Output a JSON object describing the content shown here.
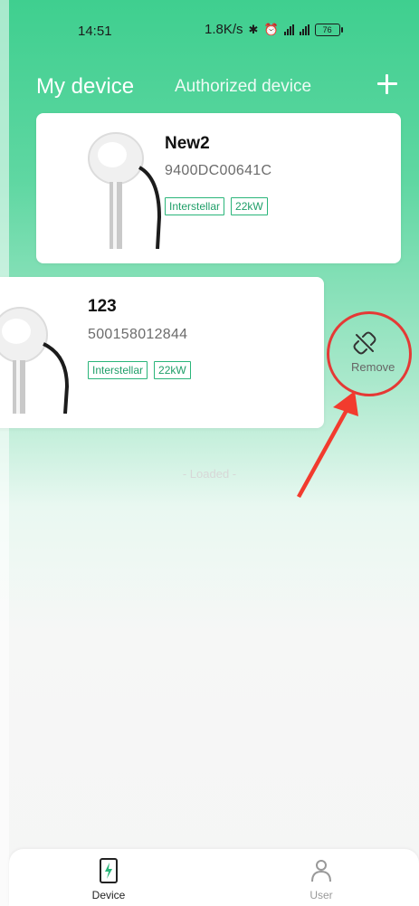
{
  "status_bar": {
    "time": "14:51",
    "network_speed": "1.8K/s",
    "battery": "76"
  },
  "header": {
    "tab_my_device": "My device",
    "tab_authorized": "Authorized device",
    "add_icon": "plus-icon"
  },
  "devices": [
    {
      "name": "New2",
      "serial": "9400DC00641C",
      "tags": [
        "Interstellar",
        "22kW"
      ]
    },
    {
      "name": "123",
      "serial": "500158012844",
      "tags": [
        "Interstellar",
        "22kW"
      ]
    }
  ],
  "swipe_action": {
    "label": "Remove",
    "icon": "unlink-icon"
  },
  "list_footer": "- Loaded -",
  "tab_bar": {
    "device_label": "Device",
    "user_label": "User"
  },
  "colors": {
    "accent": "#2ab57a",
    "header_gradient_top": "#3fcf8f",
    "annotation_red": "#e53935"
  }
}
